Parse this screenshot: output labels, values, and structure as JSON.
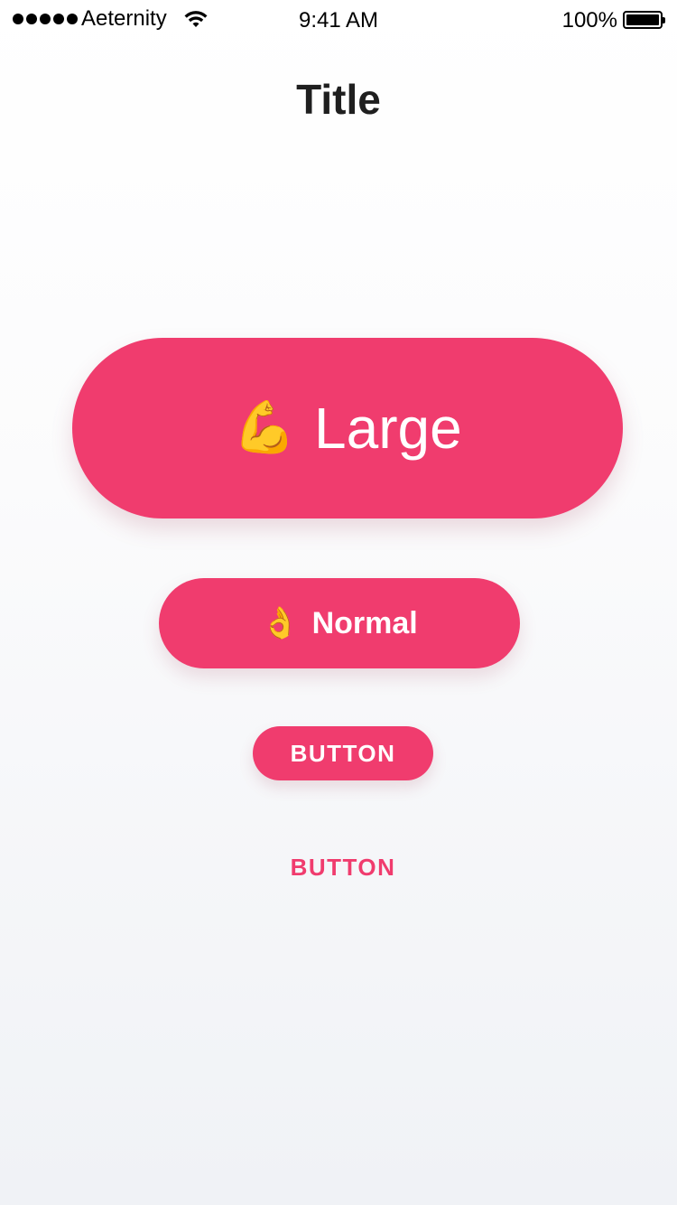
{
  "status_bar": {
    "carrier": "Aeternity",
    "time": "9:41 AM",
    "battery_percent": "100%",
    "signal_bars": 5,
    "battery_level": 1.0
  },
  "header": {
    "title": "Title"
  },
  "buttons": {
    "large": {
      "emoji": "💪",
      "label": "Large"
    },
    "normal": {
      "emoji": "👌",
      "label": "Normal"
    },
    "small": {
      "label": "BUTTON"
    },
    "text": {
      "label": "BUTTON"
    }
  },
  "colors": {
    "accent": "#f03c6e",
    "button_text": "#ffffff",
    "title_text": "#1f1f1f"
  }
}
